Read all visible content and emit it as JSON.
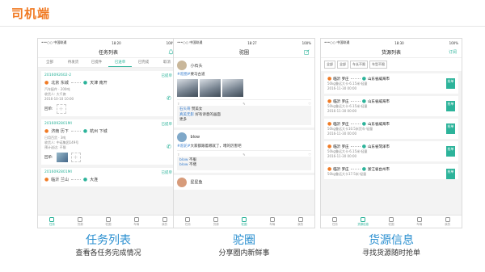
{
  "header": {
    "title": "司机端"
  },
  "phones": [
    {
      "status_carrier": "•••○○ 中国联通",
      "status_time": "18:20",
      "status_batt": "100%",
      "nav_title": "任务列表",
      "tabs": [
        "全部",
        "待发货",
        "已提件",
        "已送单",
        "已完成",
        "取消"
      ],
      "active_tab": 3,
      "cards": [
        {
          "id": "2016092602-2",
          "status": "已提单",
          "from": "北京 东城",
          "to": "天津 南开",
          "note": "汽车配件 · 200吨",
          "contact": "收货人: 大千旗",
          "date": "2016-10-10 10:00"
        },
        {
          "id": "2016092801MI",
          "status": "已提单",
          "from": "济南 历下",
          "to": "杭州 下城",
          "note": "日用百货 · 3吨",
          "contact": "收货人: 中诺集团149号",
          "date": "预计送达: 不限"
        },
        {
          "id": "2016092801MI",
          "status": "已提单",
          "from": "临沂 兰山",
          "to": "大连",
          "note": "",
          "contact": "",
          "date": ""
        }
      ],
      "receipt_label": "回单:",
      "bottom_tabs": [
        "任务",
        "货源",
        "驼圈",
        "车辆",
        "我的"
      ],
      "bottom_active": 0
    },
    {
      "status_carrier": "•••○○ 中国联通",
      "status_time": "18:27",
      "status_batt": "100%",
      "nav_title": "驼圈",
      "posts": [
        {
          "user": "小石头",
          "topic": "#驼圈#",
          "text": "要马古道",
          "likes": "赞",
          "comments": [
            {
              "who": "石头哥",
              "text": "赞美女",
              "reply": "好"
            },
            {
              "who": "真美无影",
              "text": "好有诗意的画面"
            },
            {
              "who": "",
              "text": "更多"
            }
          ]
        },
        {
          "user": "blow",
          "topic": "#驼驼#",
          "text": "大家都跟着哪就了，堵的厉害吧",
          "comments": [
            {
              "who": "blow",
              "text": "不服"
            },
            {
              "who": "blow",
              "text": "不堵"
            }
          ]
        },
        {
          "user": "星星鱼",
          "topic": "",
          "text": "",
          "comments": []
        }
      ],
      "bottom_tabs": [
        "任务",
        "货源",
        "驼圈",
        "车辆",
        "我的"
      ],
      "bottom_active": 2
    },
    {
      "status_carrier": "•••○○ 中国联通",
      "status_time": "18:30",
      "status_batt": "100%",
      "nav_title": "货源列表",
      "nav_action": "订阅",
      "filters": [
        "全部",
        "全部",
        "车长不限",
        "车型不限"
      ],
      "cargos": [
        {
          "from": "临沂 罗庄",
          "to": "山东省威海市",
          "desc": "50kg鲁远大卡·6.15米·轻量",
          "date": "2016-11-30 00:00",
          "btn": "抢单"
        },
        {
          "from": "临沂 罗庄",
          "to": "山东省威海市",
          "desc": "50kg鲁远大卡·6.15米·轻量",
          "date": "2016-11-30 00:00",
          "btn": "抢单"
        },
        {
          "from": "临沂 罗庄",
          "to": "山东省威海市",
          "desc": "50kg鲁远大卡10.5米货车·轻量",
          "date": "2016-11-30 00:00",
          "btn": "抢单"
        },
        {
          "from": "临沂 罗庄",
          "to": "山东省菏泽市",
          "desc": "50kg鲁远大卡·6.15米·轻量",
          "date": "2016-11-30 00:00",
          "btn": "抢单"
        },
        {
          "from": "临沂 罗庄",
          "to": "浙江省台州市",
          "desc": "50kg鲁远大卡17.5米·轻量",
          "date": "2016-11-30 00:00",
          "btn": "抢单"
        }
      ],
      "bottom_tabs": [
        "任务",
        "货源信息",
        "驼圈",
        "车辆",
        "我的"
      ],
      "bottom_active": 1
    }
  ],
  "captions": [
    {
      "title": "任务列表",
      "sub": "查看各任务完成情况"
    },
    {
      "title": "驼圈",
      "sub": "分享圈内新鲜事"
    },
    {
      "title": "货源信息",
      "sub": "寻找货源随时抢单"
    }
  ],
  "colors": {
    "accent_orange": "#f07a24",
    "accent_green": "#2cb39a",
    "caption_blue": "#2a8fd0"
  }
}
